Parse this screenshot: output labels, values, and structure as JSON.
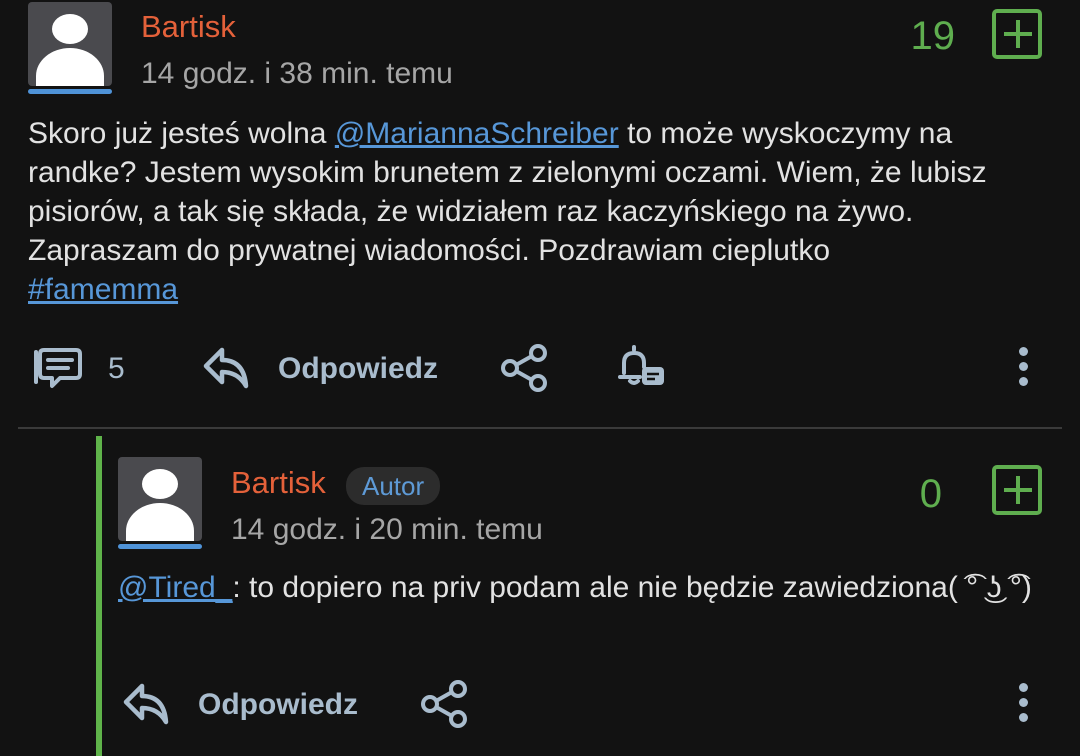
{
  "post": {
    "author": "Bartisk",
    "timestamp": "14 godz. i 38 min. temu",
    "score": "19",
    "text_before_mention": "Skoro już jesteś wolna ",
    "mention": "@MariannaSchreiber",
    "text_after_mention": " to może wyskoczymy na randke? Jestem wysokim brunetem z zielonymi oczami. Wiem, że lubisz pisiorów, a tak się składa, że widziałem raz kaczyńskiego na żywo. Zapraszam do prywatnej wiadomości. Pozdrawiam cieplutko",
    "hashtag": "#famemma",
    "comments_count": "5",
    "reply_label": "Odpowiedz"
  },
  "reply": {
    "author": "Bartisk",
    "badge": "Autor",
    "timestamp": "14 godz. i 20 min. temu",
    "score": "0",
    "mention": "@Tired_",
    "text": ": to dopiero na priv podam ale nie będzie zawiedziona( ͡° ͜ʖ ͡°)",
    "reply_label": "Odpowiedz"
  },
  "icons": {
    "comments": "comments-icon",
    "reply": "reply-arrow-icon",
    "share": "share-icon",
    "notify": "bell-message-icon",
    "more": "more-vertical-icon",
    "vote": "plus-square-icon"
  },
  "colors": {
    "background": "#121212",
    "author": "#e4613a",
    "score": "#5fae4f",
    "link": "#5797d8",
    "action": "#a9bccd"
  }
}
